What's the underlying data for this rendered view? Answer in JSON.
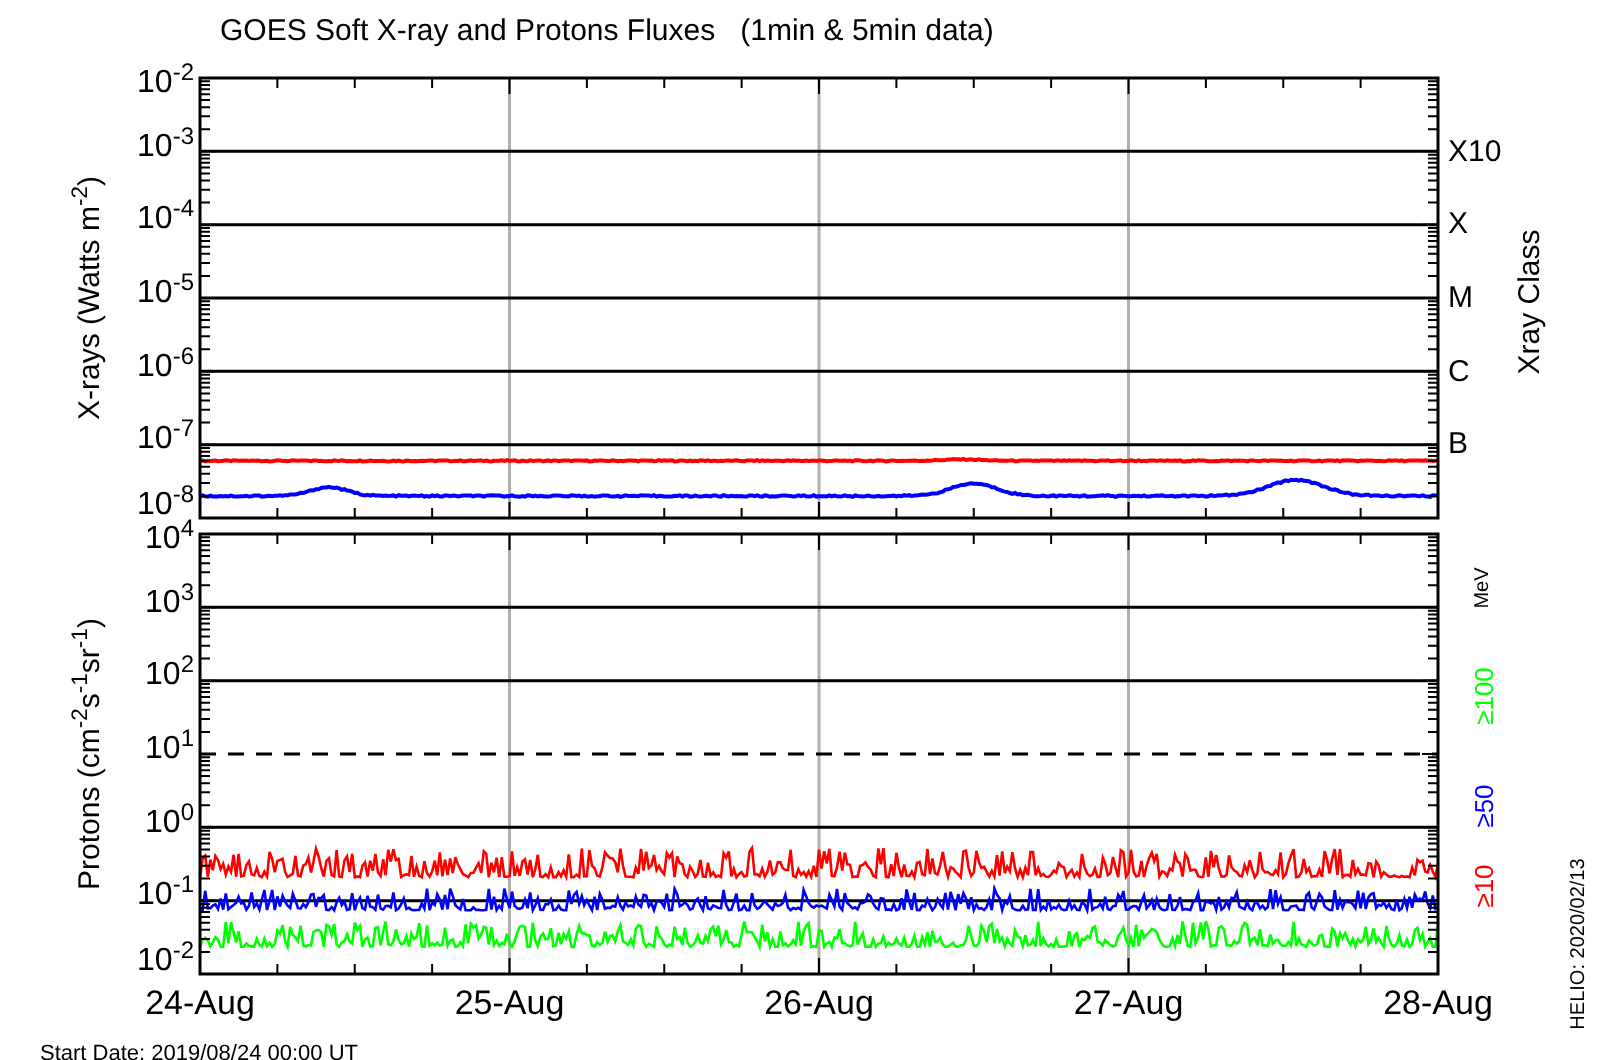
{
  "title": "GOES Soft X-ray and Protons Fluxes   (1min & 5min data)",
  "xray_panel": {
    "y_axis_title": "X-rays (Watts m$^{-2}$)",
    "y_tick_labels": [
      "10$^{-2}$",
      "10$^{-3}$",
      "10$^{-4}$",
      "10$^{-5}$",
      "10$^{-6}$",
      "10$^{-7}$",
      "10$^{-8}$"
    ],
    "class_labels": [
      "X10",
      "X",
      "M",
      "C",
      "B"
    ],
    "class_axis_title": "Xray Class"
  },
  "proton_panel": {
    "y_axis_title": "Protons (cm$^{-2}$s$^{-1}$sr$^{-1}$)",
    "y_tick_labels": [
      "10$^{4}$",
      "10$^{3}$",
      "10$^{2}$",
      "10$^{1}$",
      "10$^{0}$",
      "10$^{-1}$",
      "10$^{-2}$"
    ],
    "legend_title": "MeV",
    "series": [
      {
        "name": "≥100",
        "color": "#00ff00"
      },
      {
        "name": "≥50",
        "color": "#0000ff"
      },
      {
        "name": "≥10",
        "color": "#ff0000"
      }
    ],
    "x_tick_labels": [
      "24-Aug",
      "25-Aug",
      "26-Aug",
      "27-Aug",
      "28-Aug"
    ]
  },
  "start_date": "Start Date: 2019/08/24 00:00 UT",
  "generated": "HELIO: 2020/02/13"
}
